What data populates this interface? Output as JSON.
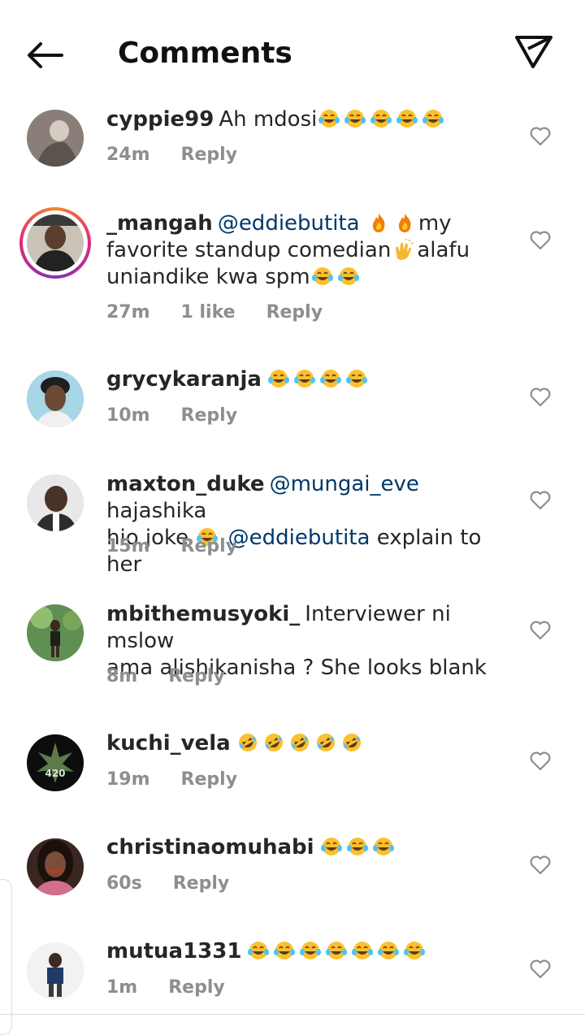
{
  "header": {
    "title": "Comments",
    "back_icon": "arrow-left-icon",
    "send_icon": "paper-plane-icon"
  },
  "comments": [
    {
      "user": "cyppie99",
      "text_parts": [
        "Ah mdosi"
      ],
      "emojis": [
        "joy",
        "joy",
        "joy",
        "joy",
        "joy"
      ],
      "time": "24m",
      "likes": "",
      "reply": "Reply"
    },
    {
      "user": "_mangah",
      "mention": "@eddiebutita",
      "text_a": "my",
      "text_b": "favorite standup comedian",
      "text_c": "alafu",
      "text_d": "uniandike kwa spm",
      "time": "27m",
      "likes": "1 like",
      "reply": "Reply"
    },
    {
      "user": "grycykaranja",
      "emojis": [
        "joy",
        "joy",
        "joy",
        "joy"
      ],
      "time": "10m",
      "reply": "Reply"
    },
    {
      "user": "maxton_duke",
      "mention": "@mungai_eve",
      "text_a": "hajashika",
      "text_b": "hio joke",
      "mention2": "@eddiebutita",
      "text_c": "explain to her",
      "time": "15m",
      "reply": "Reply"
    },
    {
      "user": "mbithemusyoki_",
      "text_a": "Interviewer ni mslow",
      "text_b": "ama alishikanisha ? She looks blank",
      "time": "8m",
      "reply": "Reply"
    },
    {
      "user": "kuchi_vela",
      "emojis": [
        "rofl",
        "rofl",
        "rofl",
        "rofl",
        "rofl"
      ],
      "time": "19m",
      "reply": "Reply"
    },
    {
      "user": "christinaomuhabi",
      "emojis": [
        "joy",
        "joy",
        "joy"
      ],
      "time": "60s",
      "reply": "Reply"
    },
    {
      "user": "mutua1331",
      "emojis": [
        "joy",
        "joy",
        "joy",
        "joy",
        "joy",
        "joy",
        "joy"
      ],
      "time": "1m",
      "reply": "Reply"
    }
  ],
  "colors": {
    "mention": "#00376b",
    "meta": "#8e8e8e",
    "text": "#262626"
  }
}
